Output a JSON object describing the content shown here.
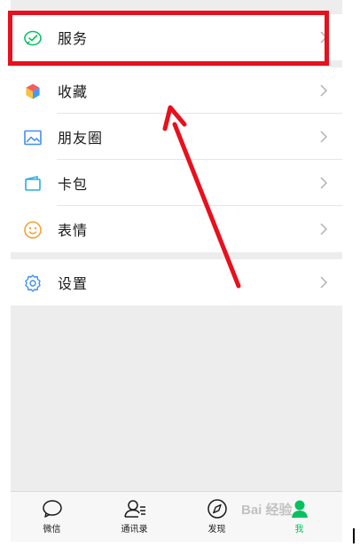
{
  "menu": {
    "items": [
      {
        "label": "服务",
        "icon": "wechat-pay-icon"
      },
      {
        "label": "收藏",
        "icon": "cube-favorites-icon"
      },
      {
        "label": "朋友圈",
        "icon": "image-moments-icon"
      },
      {
        "label": "卡包",
        "icon": "card-wallet-icon"
      },
      {
        "label": "表情",
        "icon": "smiley-icon"
      },
      {
        "label": "设置",
        "icon": "gear-icon"
      }
    ]
  },
  "tabbar": {
    "tabs": [
      {
        "label": "微信",
        "icon": "chat-bubble-icon"
      },
      {
        "label": "通讯录",
        "icon": "contacts-icon"
      },
      {
        "label": "发现",
        "icon": "compass-icon"
      },
      {
        "label": "我",
        "icon": "profile-icon",
        "active": true
      }
    ]
  },
  "watermark": {
    "text": "Bai 经验"
  },
  "colors": {
    "accent_green": "#07c160",
    "annotation_red": "#e8101c",
    "background_gray": "#ededed"
  }
}
